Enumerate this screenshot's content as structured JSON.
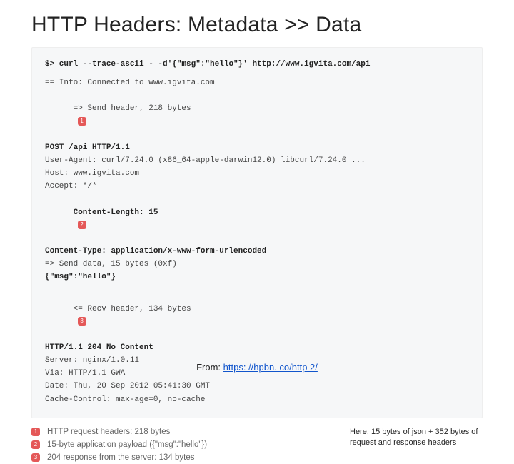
{
  "title": "HTTP Headers: Metadata >> Data",
  "code": {
    "cmd": "$> curl --trace-ascii - -d'{\"msg\":\"hello\"}' http://www.igvita.com/api",
    "info": "== Info: Connected to www.igvita.com",
    "send_header": "=> Send header, 218 bytes",
    "badge1": "1",
    "req_line": "POST /api HTTP/1.1",
    "ua": "User-Agent: curl/7.24.0 (x86_64-apple-darwin12.0) libcurl/7.24.0 ...",
    "host": "Host: www.igvita.com",
    "accept": "Accept: */*",
    "clen": "Content-Length: 15",
    "badge2": "2",
    "ctype": "Content-Type: application/x-www-form-urlencoded",
    "send_data": "=> Send data, 15 bytes (0xf)",
    "body": "{\"msg\":\"hello\"}",
    "recv_header": "<= Recv header, 134 bytes",
    "badge3": "3",
    "status": "HTTP/1.1 204 No Content",
    "server": "Server: nginx/1.0.11",
    "via": "Via: HTTP/1.1 GWA",
    "date": "Date: Thu, 20 Sep 2012 05:41:30 GMT",
    "cc": "Cache-Control: max-age=0, no-cache"
  },
  "legend": {
    "b1": "1",
    "t1": "HTTP request headers: 218 bytes",
    "b2": "2",
    "t2": "15-byte application payload ({\"msg\":\"hello\"})",
    "b3": "3",
    "t3": "204 response from the server: 134 bytes"
  },
  "annotation": "Here, 15 bytes of json + 352 bytes of request and response headers",
  "source_prefix": "From: ",
  "source_link_text": "https: //hpbn. co/http 2/",
  "source_href": "https://hpbn.co/http2/"
}
